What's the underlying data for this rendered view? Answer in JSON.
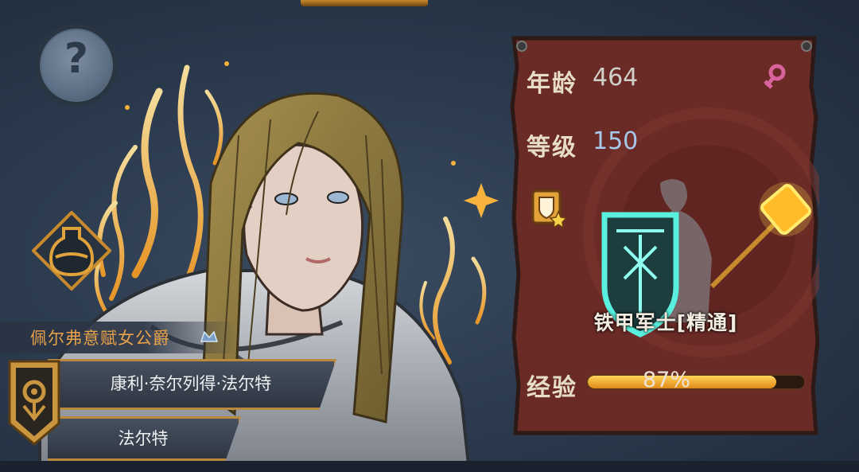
{
  "character": {
    "title": "佩尔弗意赋女公爵",
    "full_name": "康利·奈尔列得·法尔特",
    "family_name": "法尔特"
  },
  "help_button": {
    "glyph": "?"
  },
  "stats": {
    "age_label": "年龄",
    "age_value": "464",
    "level_label": "等级",
    "level_value": "150",
    "exp_label": "经验",
    "exp_text": "87%",
    "exp_fraction": 0.87
  },
  "class": {
    "name": "铁甲军士[精通]"
  },
  "icons": {
    "gender": "female-icon",
    "help": "question-icon",
    "potion": "potion-icon",
    "banner": "house-banner-icon",
    "skill": "shield-skill-icon",
    "crown": "crown-icon"
  },
  "colors": {
    "panel": "#6a2a26",
    "accent_gold": "#e7a14a",
    "level_blue": "#a6c8ea",
    "female_pink": "#d9639c"
  }
}
